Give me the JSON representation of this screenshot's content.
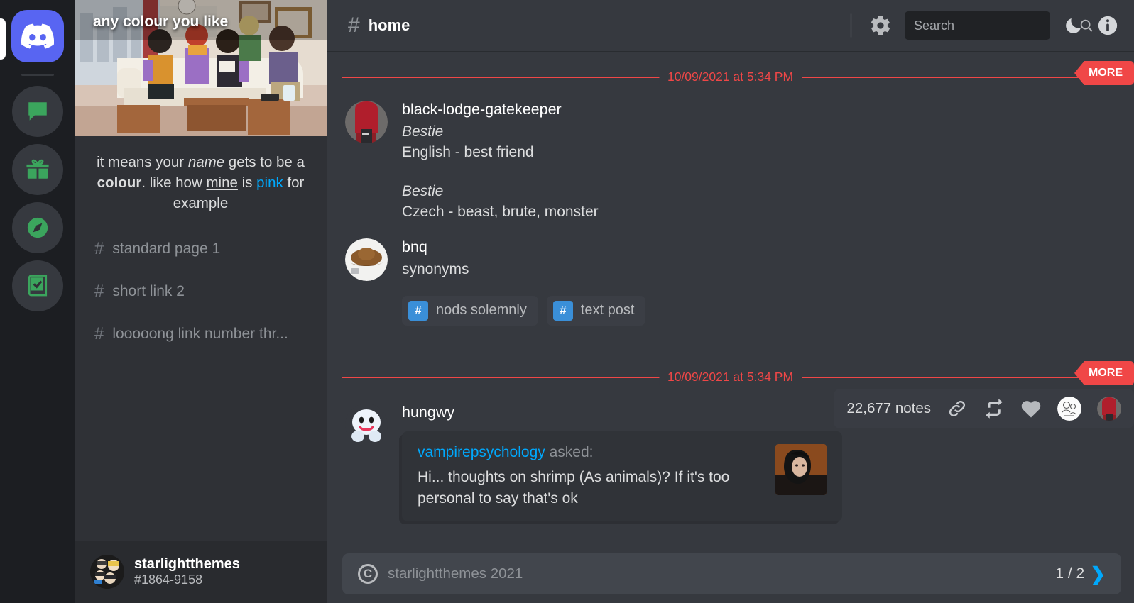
{
  "guild_rail": {
    "logo_name": "discord-logo",
    "items": [
      {
        "icon": "chat-bubble-icon"
      },
      {
        "icon": "gift-icon"
      },
      {
        "icon": "compass-icon"
      },
      {
        "icon": "checklist-book-icon"
      }
    ]
  },
  "sidebar": {
    "banner_title": "any colour you like",
    "description": {
      "part1": "it means your ",
      "italic": "name",
      "part2": " gets to be a ",
      "bold": "colour",
      "part3": ". like how ",
      "underline": "mine",
      "part4": " is ",
      "link": "pink",
      "part5": " for example"
    },
    "channels": [
      {
        "hash": "#",
        "label": "standard page 1"
      },
      {
        "hash": "#",
        "label": "short link 2"
      },
      {
        "hash": "#",
        "label": "looooong link number thr..."
      }
    ],
    "user": {
      "name": "starlightthemes",
      "tag": "#1864-9158"
    }
  },
  "topbar": {
    "hash": "#",
    "title": "home",
    "gear_icon": "gear-icon",
    "search_placeholder": "Search",
    "search_value": "",
    "search_icon": "search-icon",
    "moon_icon": "moon-icon",
    "info_icon": "info-icon"
  },
  "feed": {
    "dividers": [
      {
        "date": "10/09/2021 at 5:34 PM",
        "more": "MORE"
      },
      {
        "date": "10/09/2021 at 5:34 PM",
        "more": "MORE"
      }
    ],
    "posts": [
      {
        "author": "black-lodge-gatekeeper",
        "lines": [
          {
            "text": "Bestie",
            "style": "italic"
          },
          {
            "text": "English - best friend",
            "style": "normal"
          },
          {
            "text": "",
            "style": "gap"
          },
          {
            "text": "Bestie",
            "style": "italic"
          },
          {
            "text": "Czech - beast, brute, monster",
            "style": "normal"
          }
        ]
      },
      {
        "author": "bnq",
        "lines": [
          {
            "text": "synonyms",
            "style": "normal"
          }
        ],
        "tags": [
          {
            "hash": "#",
            "label": "nods solemnly"
          },
          {
            "hash": "#",
            "label": "text post"
          }
        ]
      },
      {
        "author": "hungwy",
        "ask": {
          "asker": "vampirepsychology",
          "asked_suffix": " asked:",
          "question": "Hi... thoughts on shrimp (As animals)? If it's too personal to say that's ok"
        }
      }
    ],
    "notes_bar": {
      "count": "22,677 notes",
      "link_icon": "link-icon",
      "reblog_icon": "reblog-icon",
      "heart_icon": "heart-icon",
      "avatar_1": "note-avatar-sketch",
      "avatar_2": "note-avatar-redhair"
    }
  },
  "footer": {
    "copyright_icon": "copyright-icon",
    "credit": "starlightthemes 2021",
    "page": "1 / 2",
    "next_icon": "chevron-right-icon"
  },
  "colors": {
    "accent_red": "#f04747",
    "accent_blue": "#00a8fc",
    "brand_blurple": "#5865f2",
    "tag_blue": "#3a8fd8",
    "sidebar_bg": "#2f3136",
    "main_bg": "#36393f"
  }
}
